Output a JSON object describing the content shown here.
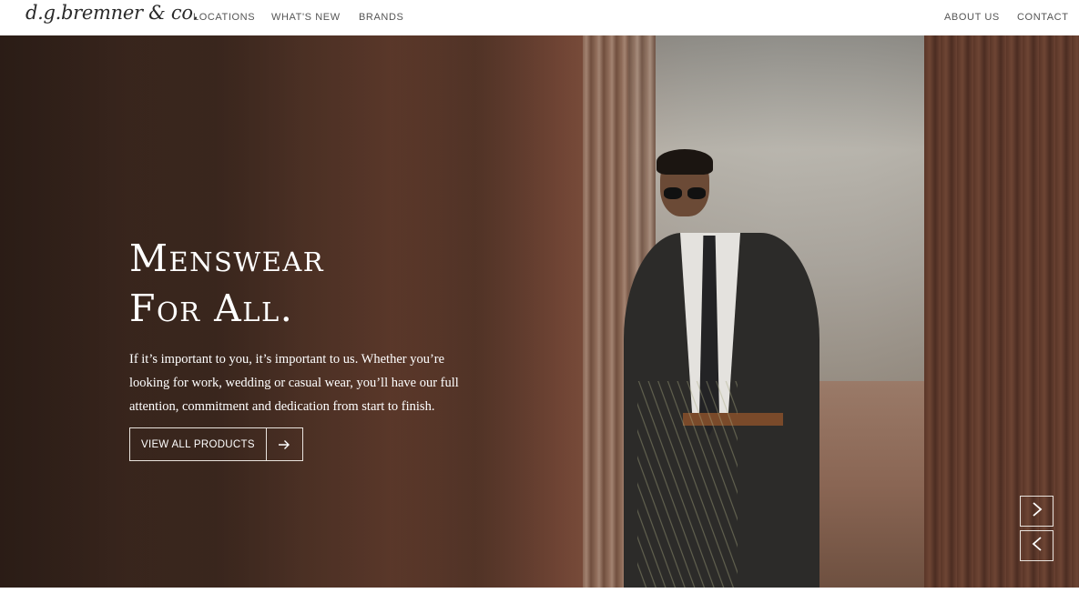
{
  "brand": {
    "logo_text": "d.g.bremner & co."
  },
  "nav": {
    "left": [
      "LOCATIONS",
      "WHAT'S NEW",
      "BRANDS"
    ],
    "right": [
      "ABOUT US",
      "CONTACT"
    ]
  },
  "hero": {
    "headline_line1": "Menswear",
    "headline_line2": "For All.",
    "description": "If it’s important to you, it’s important to us. Whether you’re looking for work, wedding or casual wear, you’ll have our full attention, commitment and dedication from start to finish.",
    "cta_label": "VIEW ALL PRODUCTS",
    "cta_icon": "arrow-right-icon",
    "slider_next_icon": "chevron-right-icon",
    "slider_prev_icon": "chevron-left-icon"
  },
  "colors": {
    "header_bg": "#ffffff",
    "nav_text": "#555555",
    "hero_text": "#ffffff",
    "button_border": "#e9e3dd"
  }
}
